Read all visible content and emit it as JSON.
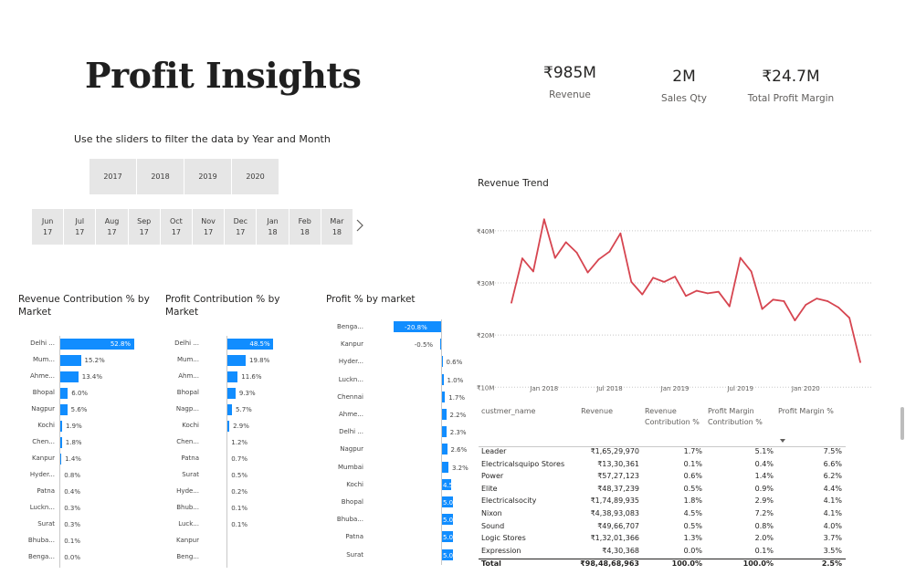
{
  "header": {
    "title": "Profit Insights"
  },
  "kpis": [
    {
      "value": "₹985M",
      "label": "Revenue"
    },
    {
      "value": "2M",
      "label": "Sales Qty"
    },
    {
      "value": "₹24.7M",
      "label": "Total Profit Margin"
    }
  ],
  "filters": {
    "instruction": "Use the sliders to filter the data by Year and Month",
    "years": [
      "2017",
      "2018",
      "2019",
      "2020"
    ],
    "months": [
      {
        "m": "Jun",
        "y": "17"
      },
      {
        "m": "Jul",
        "y": "17"
      },
      {
        "m": "Aug",
        "y": "17"
      },
      {
        "m": "Sep",
        "y": "17"
      },
      {
        "m": "Oct",
        "y": "17"
      },
      {
        "m": "Nov",
        "y": "17"
      },
      {
        "m": "Dec",
        "y": "17"
      },
      {
        "m": "Jan",
        "y": "18"
      },
      {
        "m": "Feb",
        "y": "18"
      },
      {
        "m": "Mar",
        "y": "18"
      }
    ],
    "next_icon": "chevron-right-icon"
  },
  "revenue_contribution": {
    "title": "Revenue Contribution % by Market",
    "rows": [
      {
        "label": "Delhi ...",
        "value": 52.8,
        "text": "52.8%"
      },
      {
        "label": "Mum...",
        "value": 15.2,
        "text": "15.2%"
      },
      {
        "label": "Ahme...",
        "value": 13.4,
        "text": "13.4%"
      },
      {
        "label": "Bhopal",
        "value": 6.0,
        "text": "6.0%"
      },
      {
        "label": "Nagpur",
        "value": 5.6,
        "text": "5.6%"
      },
      {
        "label": "Kochi",
        "value": 1.9,
        "text": "1.9%"
      },
      {
        "label": "Chen...",
        "value": 1.8,
        "text": "1.8%"
      },
      {
        "label": "Kanpur",
        "value": 1.4,
        "text": "1.4%"
      },
      {
        "label": "Hyder...",
        "value": 0.8,
        "text": "0.8%"
      },
      {
        "label": "Patna",
        "value": 0.4,
        "text": "0.4%"
      },
      {
        "label": "Luckn...",
        "value": 0.3,
        "text": "0.3%"
      },
      {
        "label": "Surat",
        "value": 0.3,
        "text": "0.3%"
      },
      {
        "label": "Bhuba...",
        "value": 0.1,
        "text": "0.1%"
      },
      {
        "label": "Benga...",
        "value": 0.0,
        "text": "0.0%"
      }
    ]
  },
  "profit_contribution": {
    "title": "Profit Contribution % by Market",
    "rows": [
      {
        "label": "Delhi ...",
        "value": 48.5,
        "text": "48.5%"
      },
      {
        "label": "Mum...",
        "value": 19.8,
        "text": "19.8%"
      },
      {
        "label": "Ahm...",
        "value": 11.6,
        "text": "11.6%"
      },
      {
        "label": "Bhopal",
        "value": 9.3,
        "text": "9.3%"
      },
      {
        "label": "Nagp...",
        "value": 5.7,
        "text": "5.7%"
      },
      {
        "label": "Kochi",
        "value": 2.9,
        "text": "2.9%"
      },
      {
        "label": "Chen...",
        "value": 1.2,
        "text": "1.2%"
      },
      {
        "label": "Patna",
        "value": 0.7,
        "text": "0.7%"
      },
      {
        "label": "Surat",
        "value": 0.5,
        "text": "0.5%"
      },
      {
        "label": "Hyde...",
        "value": 0.2,
        "text": "0.2%"
      },
      {
        "label": "Bhub...",
        "value": 0.1,
        "text": "0.1%"
      },
      {
        "label": "Luck...",
        "value": 0.1,
        "text": "0.1%"
      },
      {
        "label": "Kanpur",
        "value": 0,
        "text": ""
      },
      {
        "label": "Beng...",
        "value": 0,
        "text": ""
      }
    ]
  },
  "profit_by_market": {
    "title": "Profit % by market",
    "rows": [
      {
        "label": "Benga...",
        "value": -20.8,
        "text": "-20.8%"
      },
      {
        "label": "Kanpur",
        "value": -0.5,
        "text": "-0.5%"
      },
      {
        "label": "Hyder...",
        "value": 0.6,
        "text": "0.6%"
      },
      {
        "label": "Luckn...",
        "value": 1.0,
        "text": "1.0%"
      },
      {
        "label": "Chennai",
        "value": 1.7,
        "text": "1.7%"
      },
      {
        "label": "Ahme...",
        "value": 2.2,
        "text": "2.2%"
      },
      {
        "label": "Delhi ...",
        "value": 2.3,
        "text": "2.3%"
      },
      {
        "label": "Nagpur",
        "value": 2.6,
        "text": "2.6%"
      },
      {
        "label": "Mumbai",
        "value": 3.2,
        "text": "3.2%"
      },
      {
        "label": "Kochi",
        "value": 4.5,
        "text": "4.5%"
      },
      {
        "label": "Bhopal",
        "value": 5.0,
        "text": "5.0%"
      },
      {
        "label": "Bhuba...",
        "value": 5.0,
        "text": "5.0%"
      },
      {
        "label": "Patna",
        "value": 5.0,
        "text": "5.0%"
      },
      {
        "label": "Surat",
        "value": 5.0,
        "text": "5.0%"
      }
    ]
  },
  "chart_data": {
    "type": "line",
    "title": "Revenue Trend",
    "x": [
      "2017-10",
      "2017-11",
      "2017-12",
      "2018-01",
      "2018-02",
      "2018-03",
      "2018-04",
      "2018-05",
      "2018-06",
      "2018-07",
      "2018-08",
      "2018-09",
      "2018-10",
      "2018-11",
      "2018-12",
      "2019-01",
      "2019-02",
      "2019-03",
      "2019-04",
      "2019-05",
      "2019-06",
      "2019-07",
      "2019-08",
      "2019-09",
      "2019-10",
      "2019-11",
      "2019-12",
      "2020-01",
      "2020-02",
      "2020-03",
      "2020-04",
      "2020-05",
      "2020-06"
    ],
    "series": [
      {
        "values": [
          26.2,
          34.7,
          32.2,
          42.2,
          34.8,
          37.8,
          35.8,
          32.0,
          34.5,
          36.0,
          39.5,
          30.2,
          27.8,
          31.0,
          30.2,
          31.2,
          27.5,
          28.5,
          28.0,
          28.3,
          25.5,
          34.8,
          32.2,
          25.0,
          26.8,
          26.5,
          22.8,
          25.8,
          27.0,
          26.5,
          25.3,
          23.3,
          14.8
        ]
      }
    ],
    "ylim": [
      9,
      44
    ],
    "yticks": [
      {
        "v": 10,
        "t": "₹10M"
      },
      {
        "v": 20,
        "t": "₹20M"
      },
      {
        "v": 30,
        "t": "₹30M"
      },
      {
        "v": 40,
        "t": "₹40M"
      }
    ],
    "xticks": [
      {
        "i": 3,
        "t": "Jan 2018"
      },
      {
        "i": 9,
        "t": "Jul 2018"
      },
      {
        "i": 15,
        "t": "Jan 2019"
      },
      {
        "i": 21,
        "t": "Jul 2019"
      },
      {
        "i": 27,
        "t": "Jan 2020"
      }
    ],
    "color": "#d64550",
    "grid": true
  },
  "table": {
    "headers": [
      "custmer_name",
      "Revenue",
      "Revenue Contribution %",
      "Profit Margin Contribution %",
      "Profit Margin %"
    ],
    "rows": [
      [
        "Leader",
        "₹1,65,29,970",
        "1.7%",
        "5.1%",
        "7.5%"
      ],
      [
        "Electricalsquipo Stores",
        "₹13,30,361",
        "0.1%",
        "0.4%",
        "6.6%"
      ],
      [
        "Power",
        "₹57,27,123",
        "0.6%",
        "1.4%",
        "6.2%"
      ],
      [
        "Elite",
        "₹48,37,239",
        "0.5%",
        "0.9%",
        "4.4%"
      ],
      [
        "Electricalsocity",
        "₹1,74,89,935",
        "1.8%",
        "2.9%",
        "4.1%"
      ],
      [
        "Nixon",
        "₹4,38,93,083",
        "4.5%",
        "7.2%",
        "4.1%"
      ],
      [
        "Sound",
        "₹49,66,707",
        "0.5%",
        "0.8%",
        "4.0%"
      ],
      [
        "Logic Stores",
        "₹1,32,01,366",
        "1.3%",
        "2.0%",
        "3.7%"
      ],
      [
        "Expression",
        "₹4,30,368",
        "0.0%",
        "0.1%",
        "3.5%"
      ]
    ],
    "total": [
      "Total",
      "₹98,48,68,963",
      "100.0%",
      "100.0%",
      "2.5%"
    ],
    "sort_icon": "sort-desc-icon"
  },
  "colors": {
    "bar": "#118dff",
    "line": "#d64550",
    "slicer": "#e6e6e6"
  }
}
